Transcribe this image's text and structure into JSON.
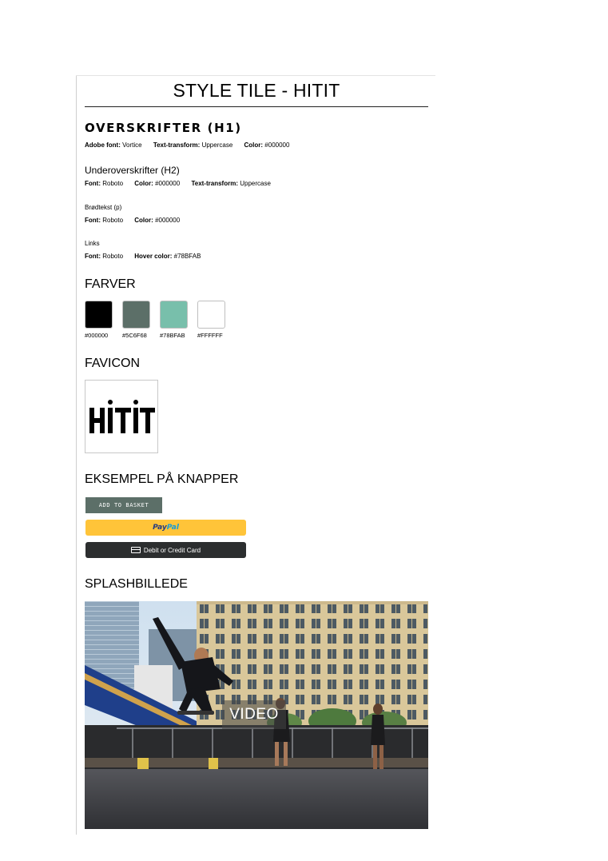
{
  "title": "STYLE TILE - HITIT",
  "h1": {
    "demo": "OVERSKRIFTER (H1)",
    "specs": [
      {
        "label": "Adobe font:",
        "value": "Vortice"
      },
      {
        "label": "Text-transform:",
        "value": "Uppercase"
      },
      {
        "label": "Color:",
        "value": "#000000"
      }
    ]
  },
  "h2": {
    "demo": "Underoverskrifter (H2)",
    "specs": [
      {
        "label": "Font:",
        "value": "Roboto"
      },
      {
        "label": "Color:",
        "value": "#000000"
      },
      {
        "label": "Text-transform:",
        "value": "Uppercase"
      }
    ]
  },
  "body_text": {
    "demo": "Brødtekst (p)",
    "specs": [
      {
        "label": "Font:",
        "value": "Roboto"
      },
      {
        "label": "Color:",
        "value": "#000000"
      }
    ]
  },
  "links": {
    "demo": "Links",
    "specs": [
      {
        "label": "Font:",
        "value": "Roboto"
      },
      {
        "label": "Hover color:",
        "value": "#78BFAB"
      }
    ]
  },
  "colors": {
    "heading": "FARVER",
    "swatches": [
      {
        "hex": "#000000",
        "color": "#000000"
      },
      {
        "hex": "#5C6F68",
        "color": "#5C6F68"
      },
      {
        "hex": "#78BFAB",
        "color": "#78BFAB"
      },
      {
        "hex": "#FFFFFF",
        "color": "#FFFFFF"
      }
    ]
  },
  "favicon": {
    "heading": "FAVICON",
    "logo_text": "HITIT"
  },
  "buttons": {
    "heading": "EKSEMPEL PÅ KNAPPER",
    "add_to_basket": "ADD TO BASKET",
    "paypal_pay": "Pay",
    "paypal_pal": "Pal",
    "card": "Debit or Credit Card"
  },
  "splash": {
    "heading": "SPLASHBILLEDE",
    "video_label": "VIDEO"
  }
}
